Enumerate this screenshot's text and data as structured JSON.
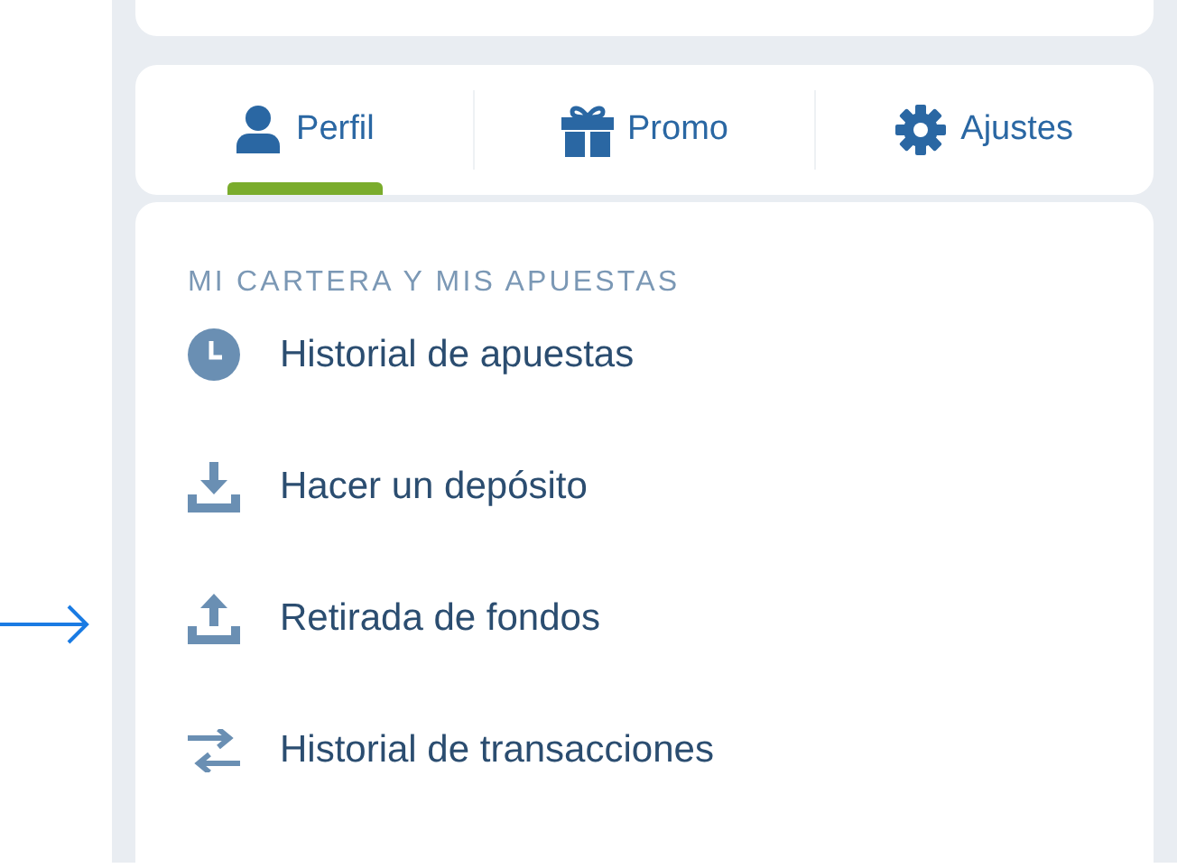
{
  "tabs": [
    {
      "label": "Perfil",
      "kind": "user",
      "selected": true
    },
    {
      "label": "Promo",
      "kind": "gift",
      "selected": false
    },
    {
      "label": "Ajustes",
      "kind": "gear",
      "selected": false
    }
  ],
  "menu": {
    "heading": "MI CARTERA Y MIS APUESTAS",
    "items": [
      {
        "label": "Historial de apuestas",
        "kind": "clock"
      },
      {
        "label": "Hacer un depósito",
        "kind": "download"
      },
      {
        "label": "Retirada de fondos",
        "kind": "upload",
        "pointed": true
      },
      {
        "label": "Historial de transacciones",
        "kind": "transfer"
      }
    ]
  }
}
